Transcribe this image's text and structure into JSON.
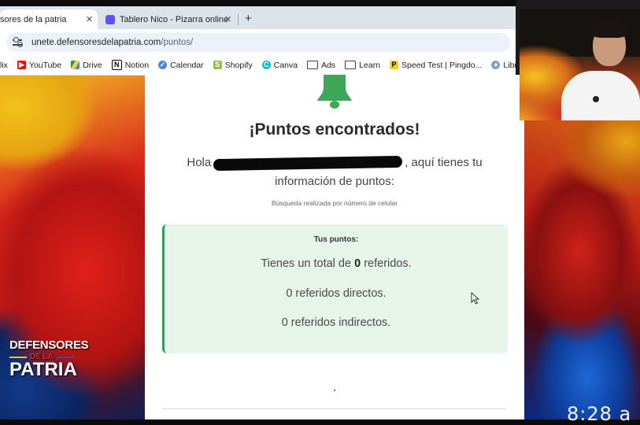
{
  "browser": {
    "tabs": [
      {
        "label": "sores de la patria",
        "active": true
      },
      {
        "label": "Tablero Nico - Pizarra online",
        "active": false
      }
    ],
    "url": {
      "domain": "unete.defensoresdelapatria.com",
      "path": "/puntos/"
    },
    "bookmarks": [
      {
        "label": "lix",
        "icon": "netflix-icon"
      },
      {
        "label": "YouTube",
        "icon": "youtube-icon"
      },
      {
        "label": "Drive",
        "icon": "drive-icon"
      },
      {
        "label": "Notion",
        "icon": "notion-icon"
      },
      {
        "label": "Calendar",
        "icon": "calendar-icon"
      },
      {
        "label": "Shopify",
        "icon": "shopify-icon"
      },
      {
        "label": "Canva",
        "icon": "canva-icon"
      },
      {
        "label": "Ads",
        "icon": "folder-icon"
      },
      {
        "label": "Learn",
        "icon": "folder-icon"
      },
      {
        "label": "Speed Test | Pingdo...",
        "icon": "pingdom-icon"
      },
      {
        "label": "Library Genesis",
        "icon": "libgen-icon"
      }
    ]
  },
  "page": {
    "title": "¡Puntos encontrados!",
    "greeting_prefix": "Hola",
    "greeting_suffix": ", aquí tienes tu información de puntos:",
    "search_note": "Búsqueda realizada por número de celular",
    "card": {
      "heading": "Tus puntos:",
      "total_prefix": "Tienes un total de",
      "total_value": "0",
      "total_suffix": "referidos.",
      "direct": "0 referidos directos.",
      "indirect": "0 referidos indirectos."
    },
    "accent_color": "#2e9e58"
  },
  "overlay": {
    "logo_line1": "DEFENSORES",
    "logo_line2": "DE LA",
    "logo_line3": "PATRIA",
    "clock": "8:28 a"
  }
}
